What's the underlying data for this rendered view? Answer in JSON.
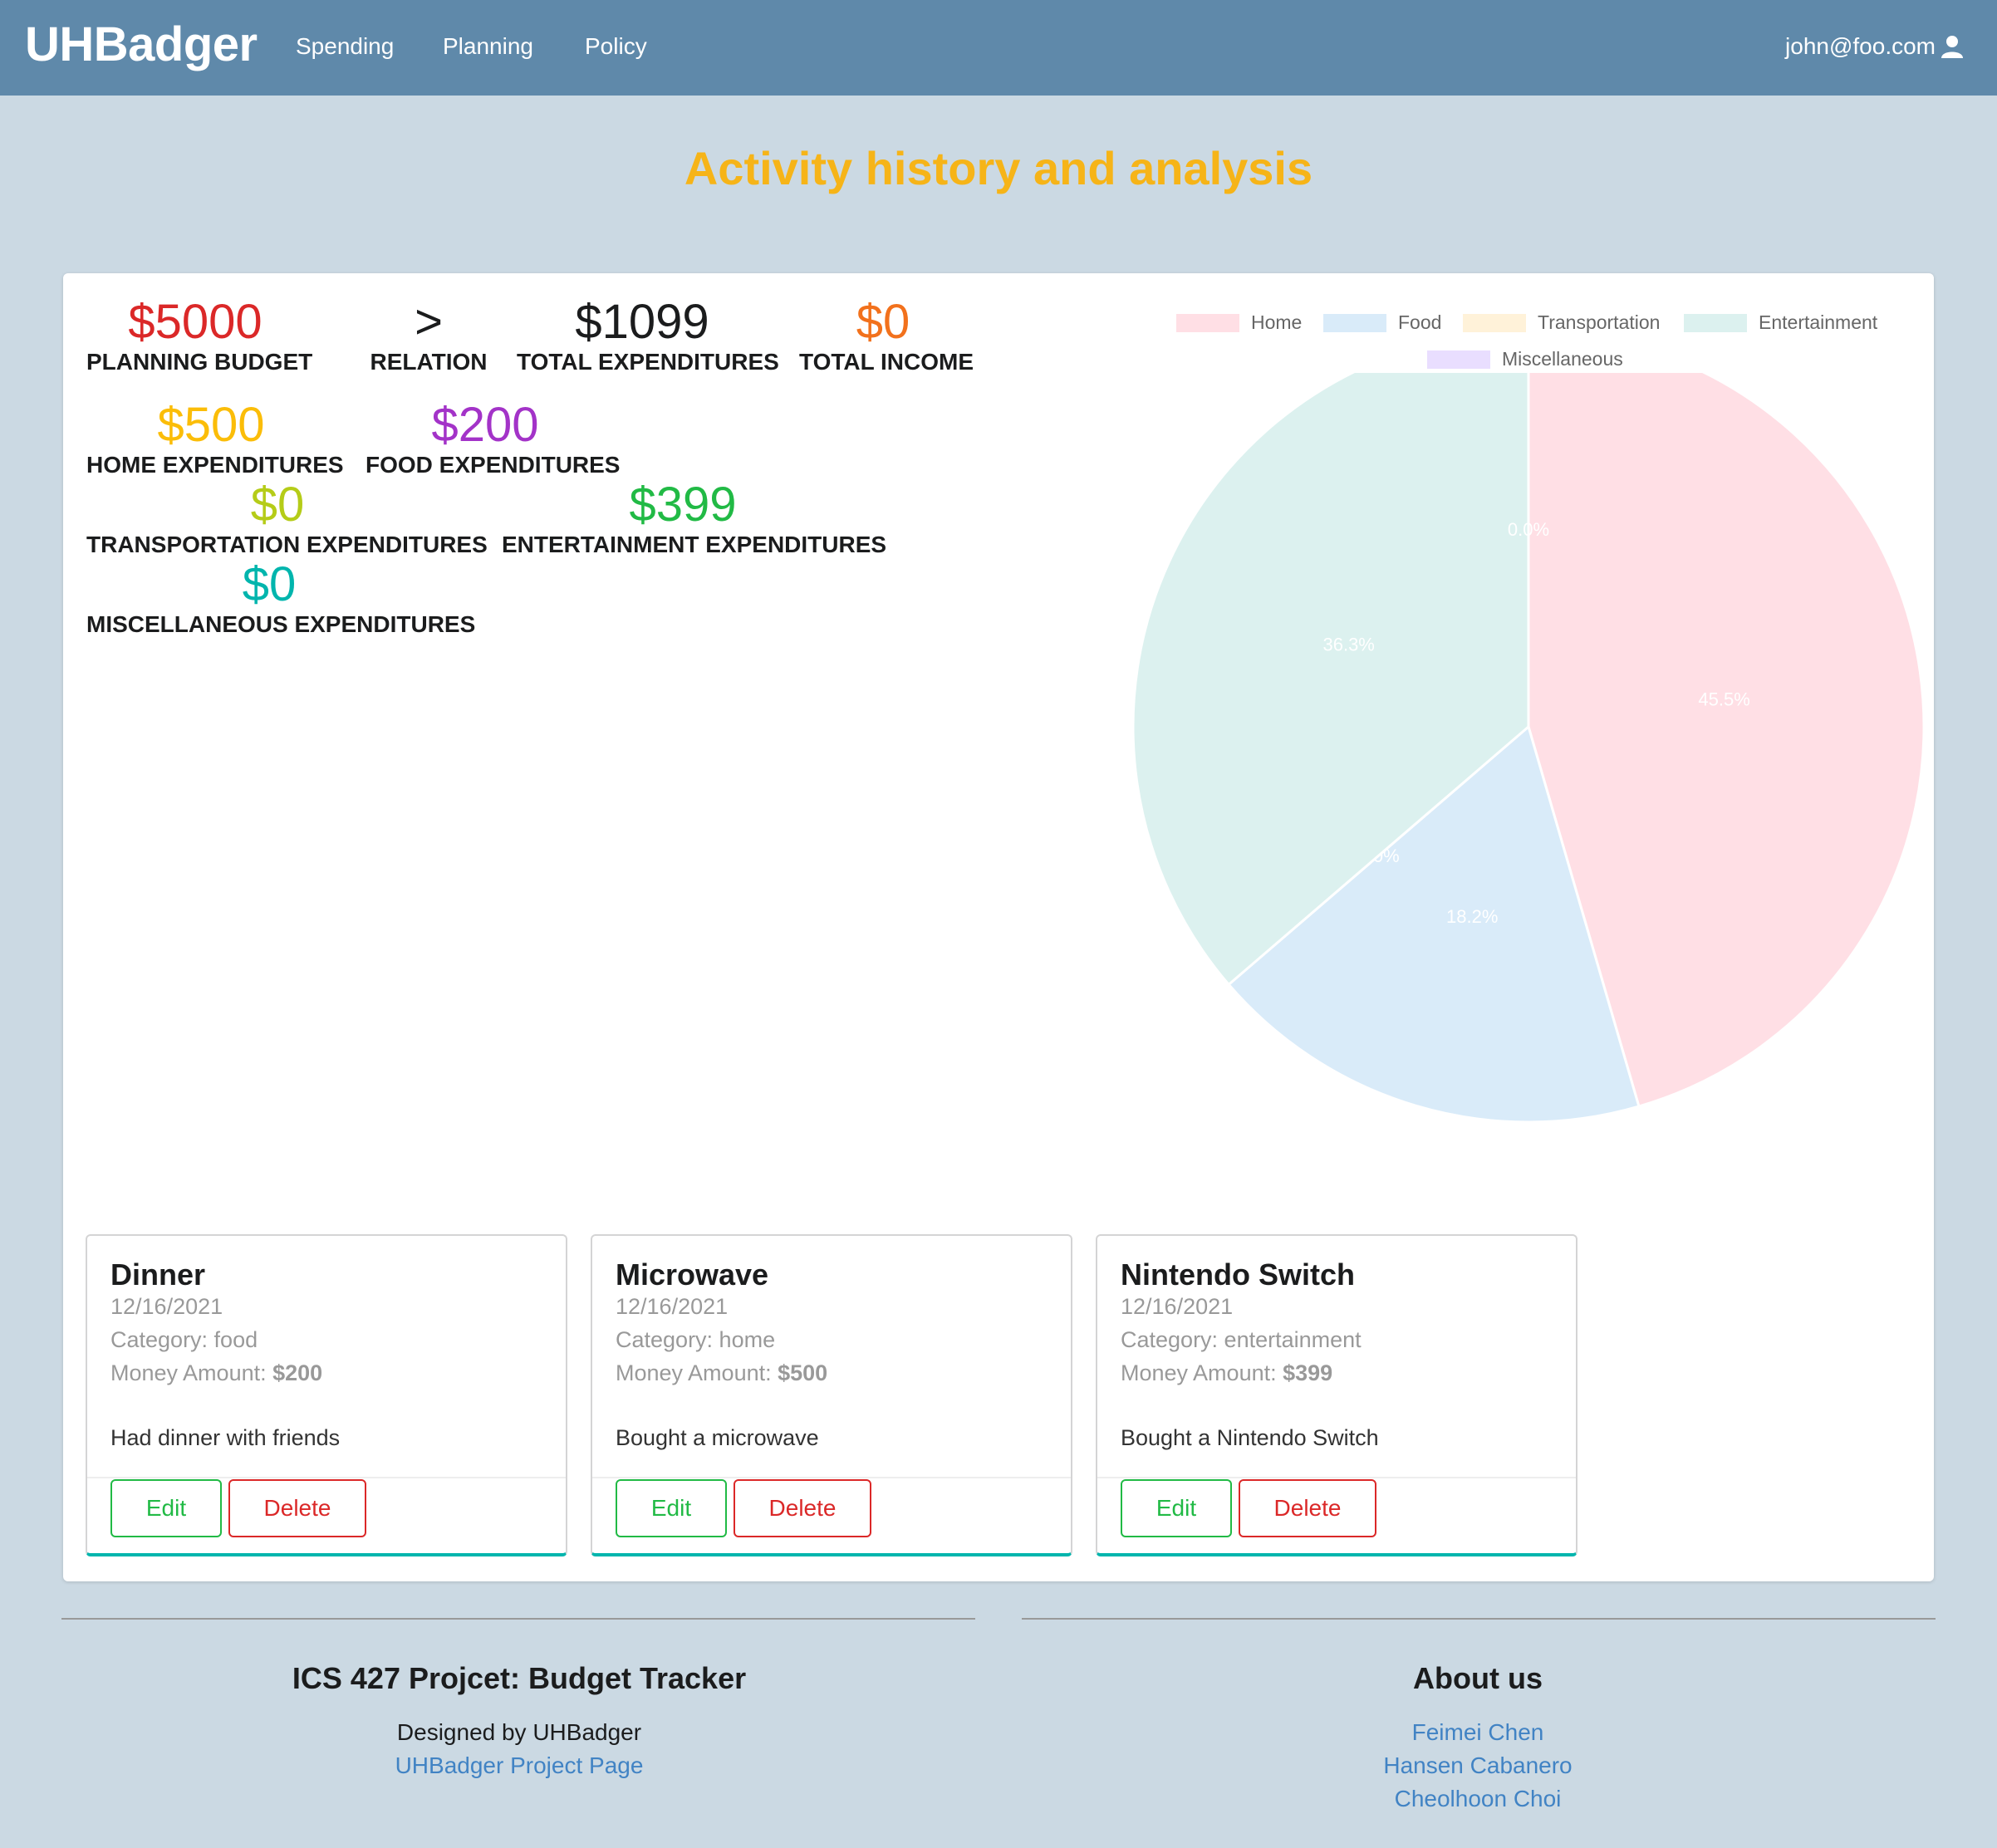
{
  "nav": {
    "brand": "UHBadger",
    "links": [
      "Spending",
      "Planning",
      "Policy"
    ],
    "user": "john@foo.com"
  },
  "page_title": "Activity history and analysis",
  "summary": {
    "planning_budget": {
      "value": "$5000",
      "label": "PLANNING BUDGET",
      "color": "#db2828"
    },
    "relation": {
      "value": ">",
      "label": "RELATION",
      "color": "#1b1c1d"
    },
    "total_expenditures": {
      "value": "$1099",
      "label": "TOTAL EXPENDITURES",
      "color": "#1b1c1d"
    },
    "total_income": {
      "value": "$0",
      "label": "TOTAL INCOME",
      "color": "#f2711c"
    },
    "home": {
      "value": "$500",
      "label": "HOME EXPENDITURES",
      "color": "#fbbd08"
    },
    "food": {
      "value": "$200",
      "label": "FOOD EXPENDITURES",
      "color": "#a333c8"
    },
    "transportation": {
      "value": "$0",
      "label": "TRANSPORTATION EXPENDITURES",
      "color": "#b5cc18"
    },
    "entertainment": {
      "value": "$399",
      "label": "ENTERTAINMENT EXPENDITURES",
      "color": "#21ba45"
    },
    "miscellaneous": {
      "value": "$0",
      "label": "MISCELLANEOUS EXPENDITURES",
      "color": "#00b5ad"
    }
  },
  "chart_data": {
    "type": "pie",
    "categories": [
      "Home",
      "Food",
      "Transportation",
      "Entertainment",
      "Miscellaneous"
    ],
    "values": [
      500,
      200,
      0,
      399,
      0
    ],
    "labels": [
      "45.5%",
      "18.2%",
      "0.0%",
      "36.3%",
      "0.0%"
    ],
    "colors": [
      "#ffdfe5",
      "#d9ebf9",
      "#fff2d9",
      "#dcf1ef",
      "#e9deff"
    ],
    "legend": "top"
  },
  "cards": [
    {
      "title": "Dinner",
      "date": "12/16/2021",
      "category": "Category: food",
      "amount_label": "Money Amount:",
      "amount": "$200",
      "description": "Had dinner with friends",
      "edit": "Edit",
      "delete": "Delete"
    },
    {
      "title": "Microwave",
      "date": "12/16/2021",
      "category": "Category: home",
      "amount_label": "Money Amount:",
      "amount": "$500",
      "description": "Bought a microwave",
      "edit": "Edit",
      "delete": "Delete"
    },
    {
      "title": "Nintendo Switch",
      "date": "12/16/2021",
      "category": "Category: entertainment",
      "amount_label": "Money Amount:",
      "amount": "$399",
      "description": "Bought a Nintendo Switch",
      "edit": "Edit",
      "delete": "Delete"
    }
  ],
  "footer": {
    "left": {
      "heading": "ICS 427 Projcet: Budget Tracker",
      "designed_by": "Designed by UHBadger",
      "link": "UHBadger Project Page"
    },
    "right": {
      "heading": "About us",
      "members": [
        "Feimei Chen",
        "Hansen Cabanero",
        "Cheolhoon Choi"
      ]
    }
  }
}
